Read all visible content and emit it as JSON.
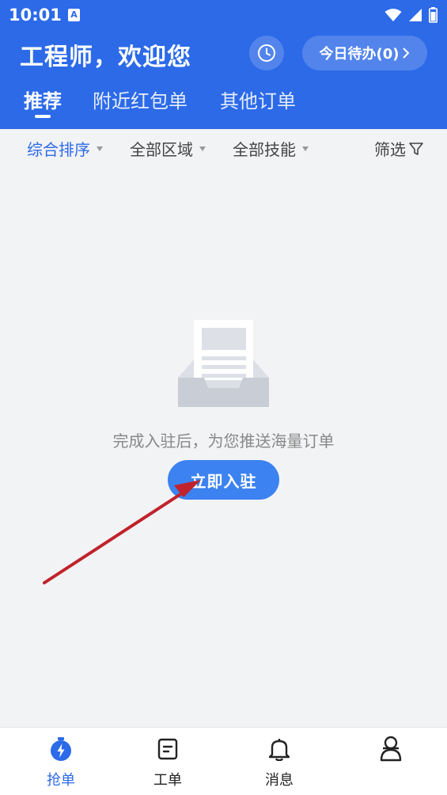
{
  "status_bar": {
    "time": "10:01",
    "notification_badge": "A"
  },
  "header": {
    "greeting": "工程师，欢迎您",
    "todo_button": "今日待办(0)",
    "tabs": [
      {
        "label": "推荐",
        "active": true
      },
      {
        "label": "附近红包单",
        "active": false
      },
      {
        "label": "其他订单",
        "active": false
      }
    ]
  },
  "filters": {
    "sort": "综合排序",
    "region": "全部区域",
    "skill": "全部技能",
    "screen": "筛选"
  },
  "empty_state": {
    "message": "完成入驻后，为您推送海量订单",
    "button": "立即入驻"
  },
  "bottom_nav": {
    "items": [
      {
        "label": "抢单",
        "icon": "grab-order-icon",
        "active": true
      },
      {
        "label": "工单",
        "icon": "work-order-icon",
        "active": false
      },
      {
        "label": "消息",
        "icon": "bell-icon",
        "active": false
      },
      {
        "label": "",
        "icon": "profile-icon",
        "active": false
      }
    ]
  },
  "colors": {
    "primary": "#2c6ae8",
    "button": "#3c82f0",
    "background": "#f2f3f5",
    "annotation_arrow": "#c0232b"
  }
}
